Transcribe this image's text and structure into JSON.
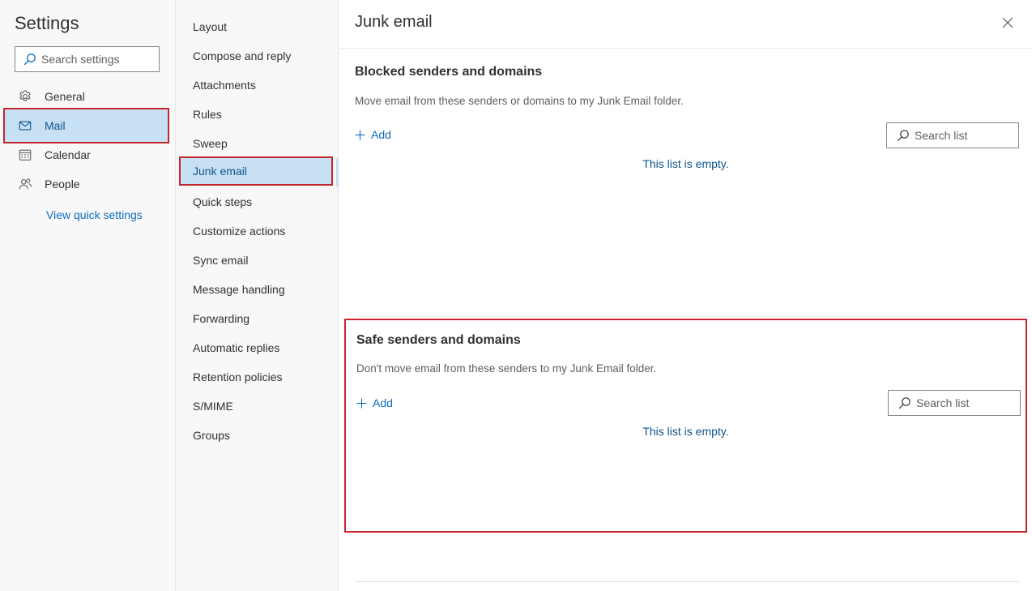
{
  "settings": {
    "title": "Settings",
    "search_placeholder": "Search settings",
    "nav": [
      {
        "label": "General",
        "icon": "gear-icon"
      },
      {
        "label": "Mail",
        "icon": "mail-icon"
      },
      {
        "label": "Calendar",
        "icon": "calendar-icon"
      },
      {
        "label": "People",
        "icon": "people-icon"
      }
    ],
    "selected_nav": "Mail",
    "quick_settings_link": "View quick settings"
  },
  "mail_settings": {
    "items": [
      "Layout",
      "Compose and reply",
      "Attachments",
      "Rules",
      "Sweep",
      "Junk email",
      "Quick steps",
      "Customize actions",
      "Sync email",
      "Message handling",
      "Forwarding",
      "Automatic replies",
      "Retention policies",
      "S/MIME",
      "Groups"
    ],
    "selected": "Junk email"
  },
  "content": {
    "title": "Junk email",
    "close_icon": "close-icon",
    "blocked": {
      "heading": "Blocked senders and domains",
      "description": "Move email from these senders or domains to my Junk Email folder.",
      "add_label": "Add",
      "search_placeholder": "Search list",
      "empty_message": "This list is empty."
    },
    "safe": {
      "heading": "Safe senders and domains",
      "description": "Don't move email from these senders to my Junk Email folder.",
      "add_label": "Add",
      "search_placeholder": "Search list",
      "empty_message": "This list is empty."
    }
  },
  "colors": {
    "accent": "#0f6cbd",
    "selected_bg": "#c7e0f4",
    "highlight_border": "#c4262e"
  }
}
